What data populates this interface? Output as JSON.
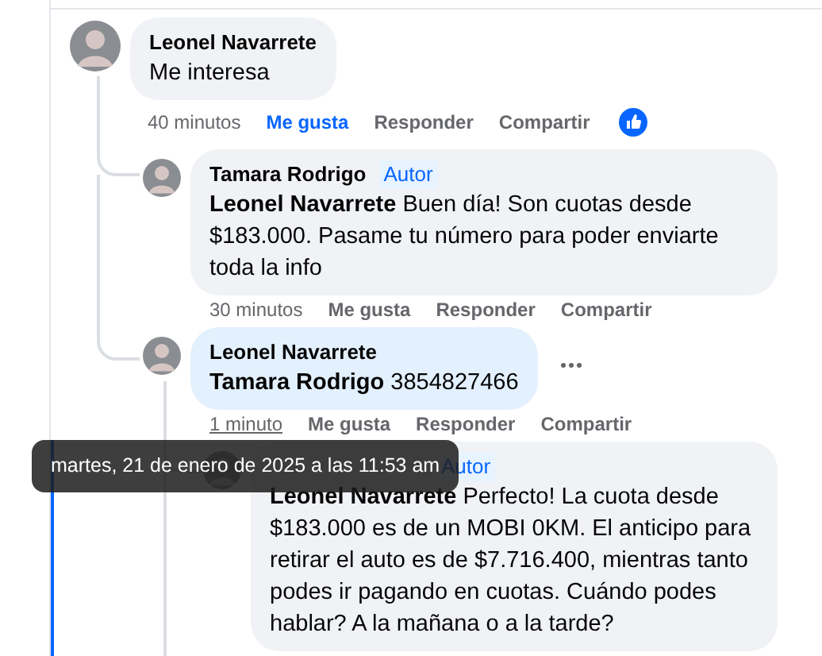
{
  "comments": [
    {
      "author": "Leonel Navarrete",
      "text": "Me interesa",
      "highlighted": false,
      "menu_visible": false,
      "time": "40 minutos",
      "time_hovered": false,
      "liked": true,
      "like_reaction": true,
      "actions": [
        "Me gusta",
        "Responder",
        "Compartir"
      ],
      "replies": [
        {
          "author": "Tamara Rodrigo",
          "badge": "Autor",
          "text": "**Leonel Navarrete** Buen día! Son cuotas desde $183.000. Pasame tu número para poder enviarte toda la info",
          "highlighted": false,
          "menu_visible": false,
          "time": "30 minutos",
          "time_hovered": false,
          "liked": false,
          "like_reaction": false,
          "actions": [
            "Me gusta",
            "Responder",
            "Compartir"
          ]
        },
        {
          "author": "Leonel Navarrete",
          "text": "**Tamara Rodrigo** 3854827466",
          "highlighted": true,
          "menu_visible": true,
          "time": "1 minuto",
          "time_hovered": true,
          "liked": false,
          "like_reaction": false,
          "actions": [
            "Me gusta",
            "Responder",
            "Compartir"
          ],
          "replies": [
            {
              "badge": "Autor",
              "text": "**Leonel Navarrete** Perfecto! La cuota desde $183.000 es de un MOBI 0KM. El anticipo para retirar el auto es de $7.716.400, mientras tanto podes ir pagando en cuotas. Cuándo podes hablar? A la mañana o a la tarde?",
              "highlighted": false,
              "menu_visible": false
            }
          ]
        }
      ]
    }
  ],
  "tooltip": {
    "text": "martes, 21 de enero de 2025 a las 11:53 am"
  }
}
